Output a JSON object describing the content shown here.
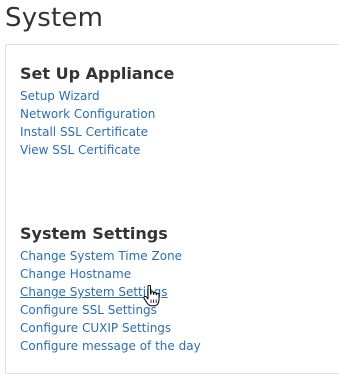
{
  "page": {
    "title": "System"
  },
  "appliance_section": {
    "heading": "Set Up Appliance",
    "links": [
      {
        "label": "Setup Wizard"
      },
      {
        "label": "Network Configuration"
      },
      {
        "label": "Install SSL Certificate"
      },
      {
        "label": "View SSL Certificate"
      }
    ]
  },
  "settings_section": {
    "heading": "System Settings",
    "links": [
      {
        "label": "Change System Time Zone"
      },
      {
        "label": "Change Hostname"
      },
      {
        "label": "Change System Settings",
        "state": "hovered"
      },
      {
        "label": "Configure SSL Settings"
      },
      {
        "label": "Configure CUXIP Settings"
      },
      {
        "label": "Configure message of the day"
      }
    ]
  },
  "colors": {
    "link": "#2a6fb0",
    "heading": "#333333",
    "panel_border": "#e1e1e1"
  },
  "icons": {
    "cursor": "hand-pointer-icon"
  }
}
